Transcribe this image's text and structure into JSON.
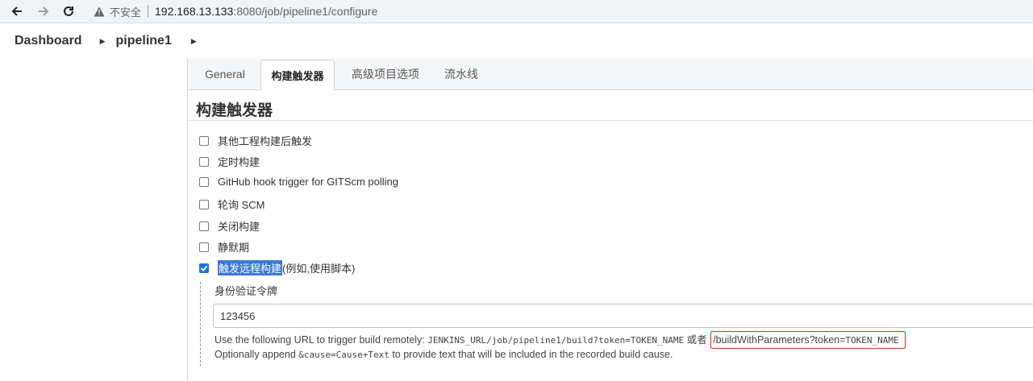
{
  "browser": {
    "security_label": "不安全",
    "url_host": "192.168.13.133",
    "url_path": ":8080/job/pipeline1/configure"
  },
  "breadcrumbs": {
    "dashboard": "Dashboard",
    "job": "pipeline1"
  },
  "tabs": [
    {
      "label": "General",
      "active": false
    },
    {
      "label": "构建触发器",
      "active": true
    },
    {
      "label": "高级项目选项",
      "active": false
    },
    {
      "label": "流水线",
      "active": false
    }
  ],
  "section": {
    "title": "构建触发器"
  },
  "triggers": [
    {
      "label": "其他工程构建后触发",
      "checked": false
    },
    {
      "label": "定时构建",
      "checked": false
    },
    {
      "label": "GitHub hook trigger for GITScm polling",
      "checked": false
    },
    {
      "label": "轮询 SCM",
      "checked": false
    },
    {
      "label": "关闭构建",
      "checked": false
    },
    {
      "label": "静默期",
      "checked": false
    },
    {
      "label": "触发远程构建",
      "suffix": " (例如,使用脚本)",
      "checked": true
    }
  ],
  "remote": {
    "token_label": "身份验证令牌",
    "token_value": "123456",
    "help_prefix": "Use the following URL to trigger build remotely: ",
    "help_url1": "JENKINS_URL/job/pipeline1/build?token=TOKEN_NAME",
    "help_or": " 或者 ",
    "help_url2_text": "/buildWithParameters?token=",
    "help_url2_mono": "TOKEN_NAME",
    "help2_prefix": "Optionally append ",
    "help2_code": "&cause=Cause+Text",
    "help2_suffix": " to provide text that will be included in the recorded build cause."
  }
}
